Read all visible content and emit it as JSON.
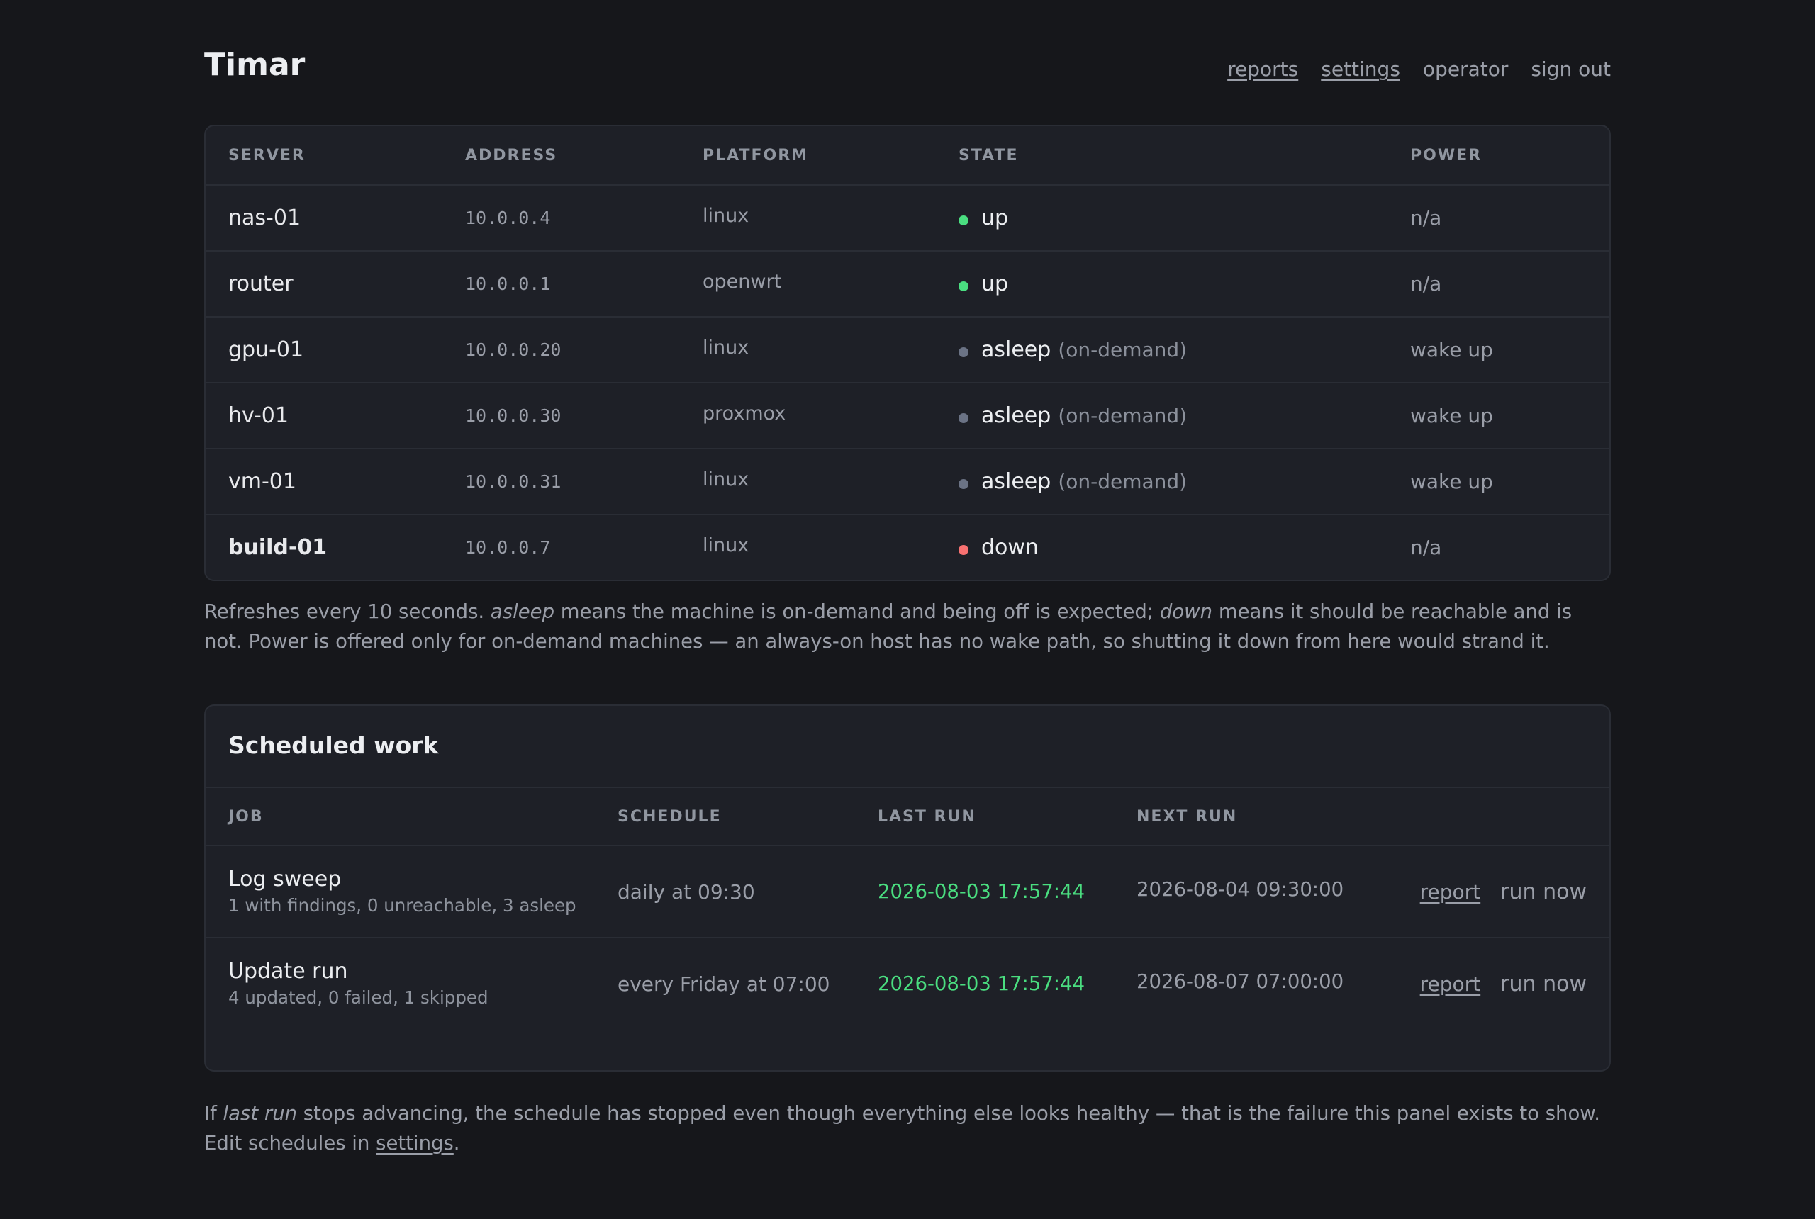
{
  "app": {
    "title": "Timar"
  },
  "nav": {
    "reports": "reports",
    "settings": "settings",
    "user": "operator",
    "sign_out": "sign out"
  },
  "servers": {
    "headers": {
      "server": "SERVER",
      "address": "ADDRESS",
      "platform": "PLATFORM",
      "state": "STATE",
      "power": "POWER"
    },
    "rows": [
      {
        "name": "nas-01",
        "address": "10.0.0.4",
        "platform": "linux",
        "state": "up",
        "state_note": "",
        "power": "n/a",
        "status_color": "#4ade80"
      },
      {
        "name": "router",
        "address": "10.0.0.1",
        "platform": "openwrt",
        "state": "up",
        "state_note": "",
        "power": "n/a",
        "status_color": "#4ade80"
      },
      {
        "name": "gpu-01",
        "address": "10.0.0.20",
        "platform": "linux",
        "state": "asleep",
        "state_note": "(on-demand)",
        "power": "wake up",
        "status_color": "#6b7385"
      },
      {
        "name": "hv-01",
        "address": "10.0.0.30",
        "platform": "proxmox",
        "state": "asleep",
        "state_note": "(on-demand)",
        "power": "wake up",
        "status_color": "#6b7385"
      },
      {
        "name": "vm-01",
        "address": "10.0.0.31",
        "platform": "linux",
        "state": "asleep",
        "state_note": "(on-demand)",
        "power": "wake up",
        "status_color": "#6b7385"
      },
      {
        "name": "build-01",
        "address": "10.0.0.7",
        "platform": "linux",
        "state": "down",
        "state_note": "",
        "power": "n/a",
        "status_color": "#f87171"
      }
    ]
  },
  "servers_note": {
    "p1": "Refreshes every 10 seconds. ",
    "em1": "asleep",
    "p2": " means the machine is on-demand and being off is expected; ",
    "em2": "down",
    "p3": " means it should be reachable and is not. Power is offered only for on-demand machines — an always-on host has no wake path, so shutting it down from here would strand it."
  },
  "scheduled": {
    "title": "Scheduled work",
    "headers": {
      "job": "JOB",
      "schedule": "SCHEDULE",
      "last_run": "LAST RUN",
      "next_run": "NEXT RUN"
    },
    "rows": [
      {
        "job": "Log sweep",
        "summary": "1 with findings, 0 unreachable, 3 asleep",
        "schedule": "daily at 09:30",
        "last_run": "2026-08-03 17:57:44",
        "next_run": "2026-08-04 09:30:00",
        "report": "report",
        "run_now": "run now"
      },
      {
        "job": "Update run",
        "summary": "4 updated, 0 failed, 1 skipped",
        "schedule": "every Friday at 07:00",
        "last_run": "2026-08-03 17:57:44",
        "next_run": "2026-08-07 07:00:00",
        "report": "report",
        "run_now": "run now"
      }
    ]
  },
  "footer_note": {
    "p1": "If ",
    "em": "last run",
    "p2": " stops advancing, the schedule has stopped even though everything else looks healthy — that is the failure this panel exists to show. Edit schedules in ",
    "link": "settings",
    "p3": "."
  },
  "colors": {
    "background": "#16171b",
    "panel": "#1e2027",
    "ok": "#4ade80",
    "asleep": "#6b7385",
    "down": "#f87171"
  }
}
